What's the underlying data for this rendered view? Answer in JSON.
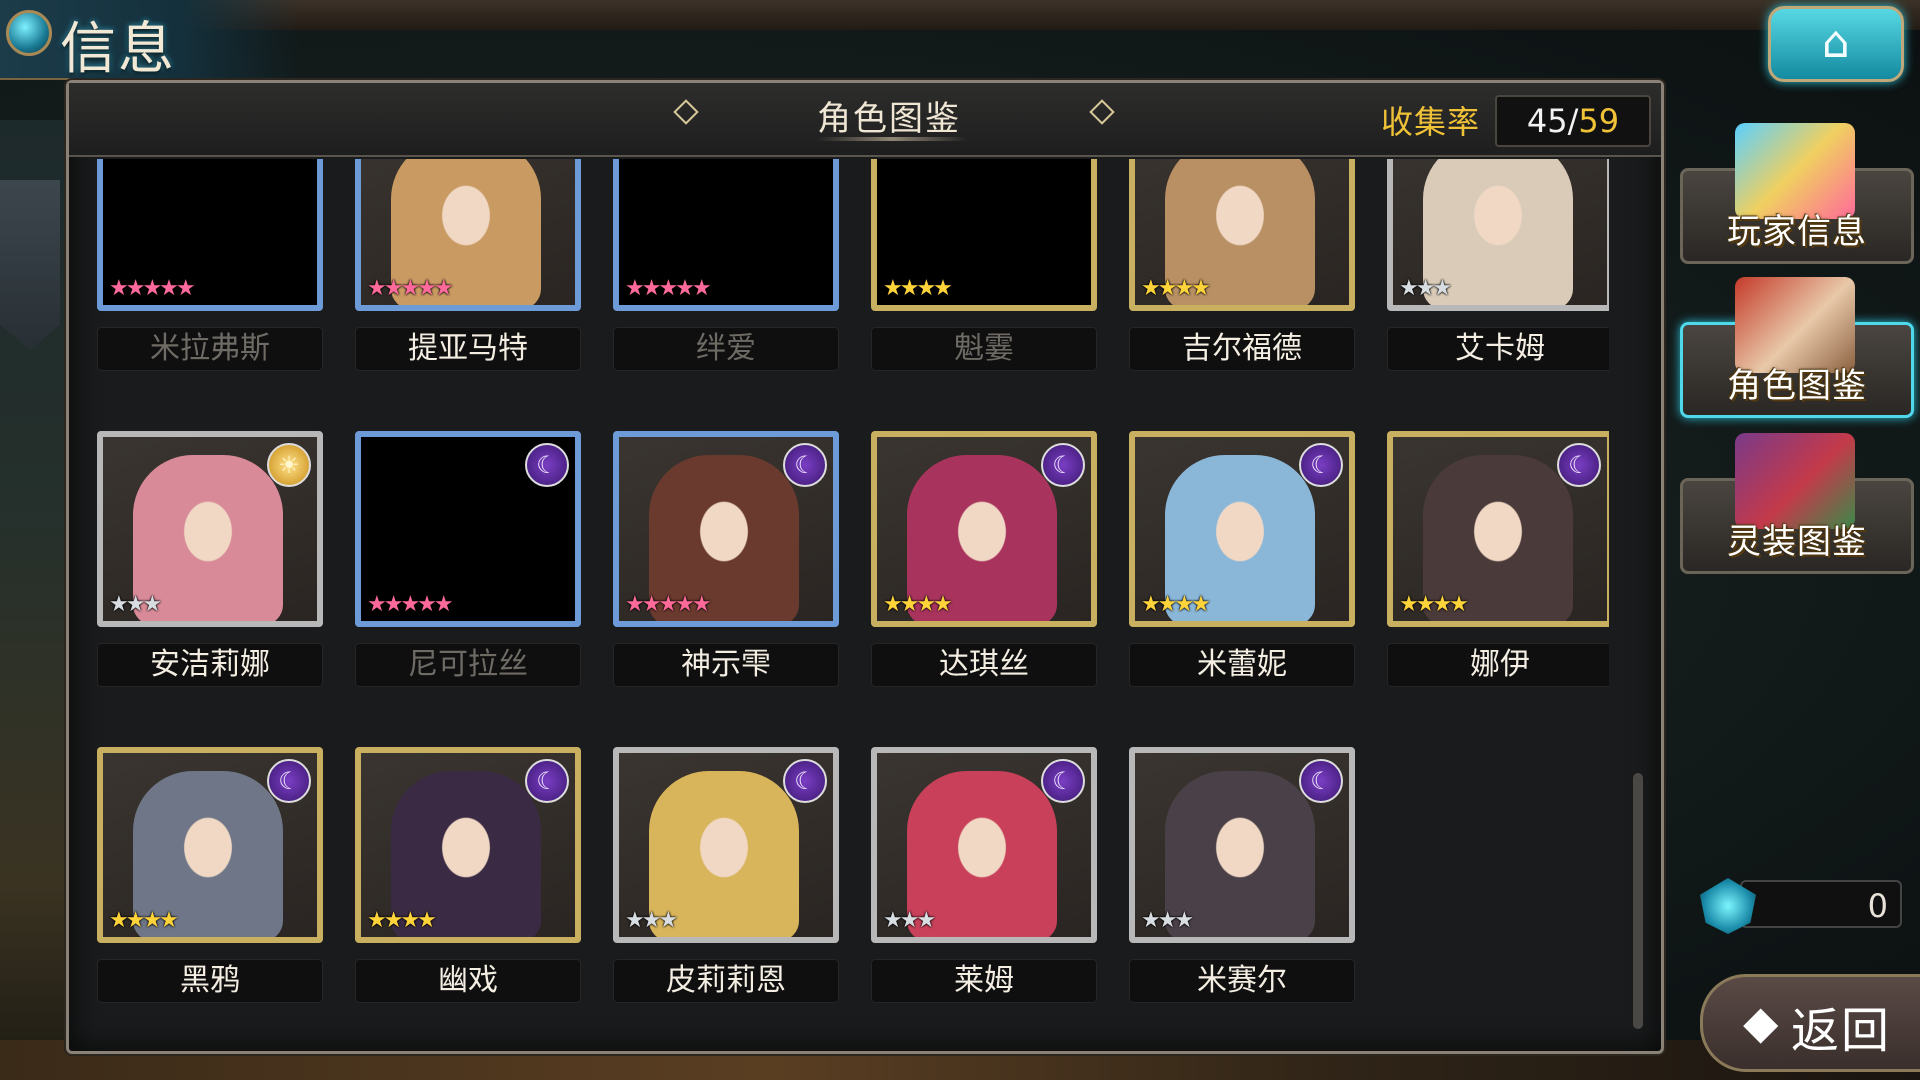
{
  "screen": {
    "title": "信息"
  },
  "panel": {
    "title": "角色图鉴",
    "collect_label": "收集率",
    "collect_current": "45",
    "collect_separator": "/",
    "collect_total": "59"
  },
  "cards": [
    {
      "name": "米拉弗斯",
      "locked": true,
      "frame": "blue",
      "stars": 5,
      "star_style": "rainbow",
      "element": "",
      "art": "#000000"
    },
    {
      "name": "提亚马特",
      "locked": false,
      "frame": "blue",
      "stars": 5,
      "star_style": "rainbow",
      "element": "",
      "art": "#c99a62"
    },
    {
      "name": "绊爱",
      "locked": true,
      "frame": "blue",
      "stars": 5,
      "star_style": "rainbow",
      "element": "",
      "art": "#000000"
    },
    {
      "name": "魁霎",
      "locked": true,
      "frame": "gold",
      "stars": 4,
      "star_style": "gold",
      "element": "",
      "art": "#000000"
    },
    {
      "name": "吉尔福德",
      "locked": false,
      "frame": "gold",
      "stars": 4,
      "star_style": "gold",
      "element": "",
      "art": "#b89064"
    },
    {
      "name": "艾卡姆",
      "locked": false,
      "frame": "silver",
      "stars": 3,
      "star_style": "silver",
      "element": "",
      "art": "#d9cbb8"
    },
    {
      "name": "安洁莉娜",
      "locked": false,
      "frame": "silver",
      "stars": 3,
      "star_style": "silver",
      "element": "sun",
      "art": "#d88a98"
    },
    {
      "name": "尼可拉丝",
      "locked": true,
      "frame": "blue",
      "stars": 5,
      "star_style": "rainbow",
      "element": "moon",
      "art": "#000000"
    },
    {
      "name": "神示雫",
      "locked": false,
      "frame": "blue",
      "stars": 5,
      "star_style": "rainbow",
      "element": "moon",
      "art": "#6a3a2e"
    },
    {
      "name": "达琪丝",
      "locked": false,
      "frame": "gold",
      "stars": 4,
      "star_style": "gold",
      "element": "moon",
      "art": "#a8345e"
    },
    {
      "name": "米蕾妮",
      "locked": false,
      "frame": "gold",
      "stars": 4,
      "star_style": "gold",
      "element": "moon",
      "art": "#8ab6d8"
    },
    {
      "name": "娜伊",
      "locked": false,
      "frame": "gold",
      "stars": 4,
      "star_style": "gold",
      "element": "moon",
      "art": "#4a3a3a"
    },
    {
      "name": "黑鸦",
      "locked": false,
      "frame": "gold",
      "stars": 4,
      "star_style": "gold",
      "element": "moon",
      "art": "#6e7688"
    },
    {
      "name": "幽戏",
      "locked": false,
      "frame": "gold",
      "stars": 4,
      "star_style": "gold",
      "element": "moon",
      "art": "#3a2a44"
    },
    {
      "name": "皮莉莉恩",
      "locked": false,
      "frame": "silver",
      "stars": 3,
      "star_style": "silver",
      "element": "moon",
      "art": "#d8b45a"
    },
    {
      "name": "莱姆",
      "locked": false,
      "frame": "silver",
      "stars": 3,
      "star_style": "silver",
      "element": "moon",
      "art": "#c8405a"
    },
    {
      "name": "米赛尔",
      "locked": false,
      "frame": "silver",
      "stars": 3,
      "star_style": "silver",
      "element": "moon",
      "art": "#4a4048"
    }
  ],
  "side": {
    "player_info": "玩家信息",
    "character_codex": "角色图鉴",
    "equipment_codex": "灵装图鉴"
  },
  "currency": {
    "value": "0"
  },
  "back": {
    "label": "返回",
    "arrow": "◆"
  },
  "icons": {
    "home": "home-icon",
    "moon": "☾",
    "sun": "☀",
    "star": "★"
  },
  "colors": {
    "accent_gold": "#f0c238",
    "accent_cyan": "#4fd8ea",
    "panel_bg": "#1a1b1c"
  }
}
